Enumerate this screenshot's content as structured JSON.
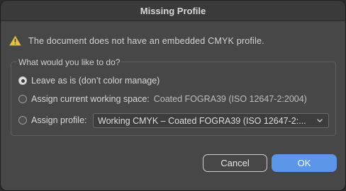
{
  "dialog": {
    "title": "Missing Profile",
    "message": "The document does not have an embedded CMYK profile.",
    "group_label": "What would you like to do?",
    "options": [
      {
        "label": "Leave as is (don’t color manage)",
        "selected": true
      },
      {
        "label": "Assign current working space:",
        "detail": "Coated FOGRA39 (ISO 12647-2:2004)",
        "selected": false
      },
      {
        "label": "Assign profile:",
        "selected": false
      }
    ],
    "profile_select_value": "Working CMYK – Coated FOGRA39 (ISO 12647-2:...",
    "cancel_label": "Cancel",
    "ok_label": "OK"
  },
  "colors": {
    "accent": "#5b96e8",
    "warning": "#e8c14a",
    "background": "#474747"
  },
  "icons": {
    "warning": "warning-triangle-icon",
    "dropdown": "chevron-updown-icon"
  }
}
